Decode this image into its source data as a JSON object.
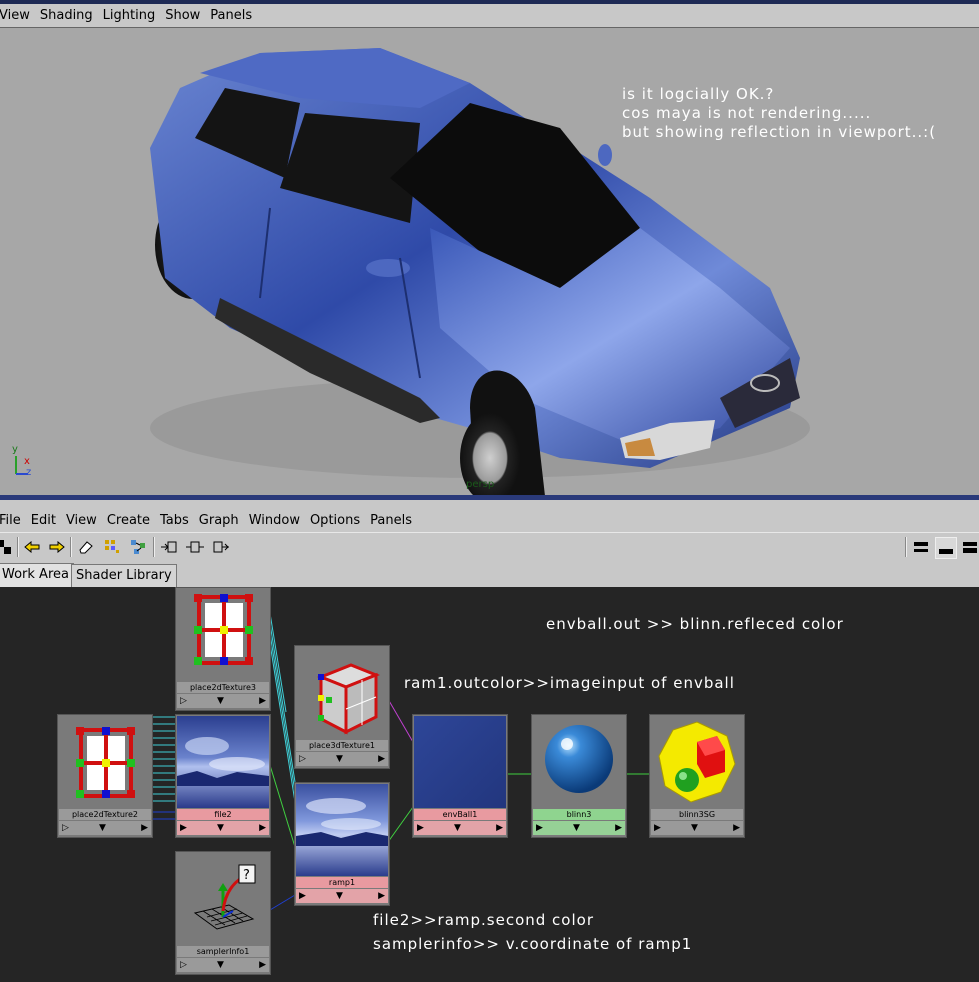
{
  "viewport_menu": [
    "View",
    "Shading",
    "Lighting",
    "Show",
    "Panels"
  ],
  "viewport_notes": [
    "is it logcially OK.?",
    "cos maya is not rendering.....",
    "but showing reflection in viewport..:("
  ],
  "axis": {
    "x": "x",
    "y": "y",
    "z": "z"
  },
  "camera_label": "persp",
  "hypershade_menu": [
    "File",
    "Edit",
    "View",
    "Create",
    "Tabs",
    "Graph",
    "Window",
    "Options",
    "Panels"
  ],
  "tabs": [
    "Work Area",
    "Shader Library"
  ],
  "nodes": {
    "place2dTexture3": "place2dTexture3",
    "place3dTexture1": "place3dTexture1",
    "place2dTexture2": "place2dTexture2",
    "file2": "file2",
    "ramp1": "ramp1",
    "envBall1": "envBall1",
    "blinn3": "blinn3",
    "blinn3SG": "blinn3SG",
    "samplerInfo1": "samplerInfo1"
  },
  "graph_notes": {
    "envball": "envball.out >> blinn.refleced color",
    "ramp": "ram1.outcolor>>imageinput of envball",
    "file": "file2>>ramp.second color",
    "sampler": "samplerinfo>> v.coordinate of ramp1"
  },
  "colors": {
    "selected_node": "#e89aa0",
    "shader_node": "#8fd48f",
    "graph_bg": "#252525",
    "viewport_bg": "#a7a7a7"
  }
}
